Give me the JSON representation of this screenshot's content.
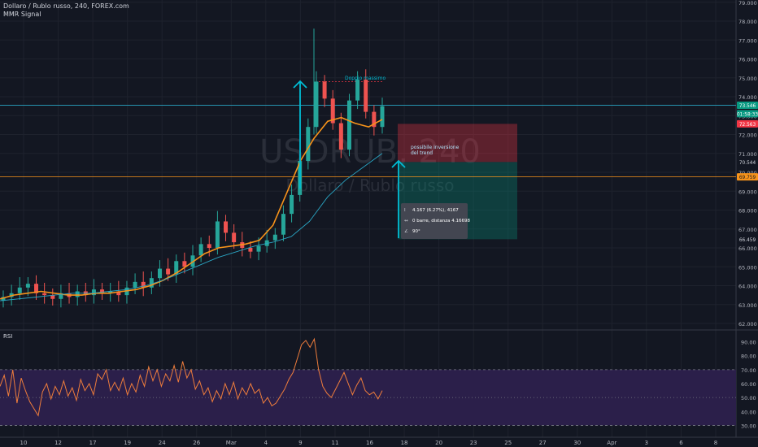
{
  "header": {
    "symbol_line": "Dollaro / Rublo russo, 240, FOREX.com",
    "indicator": "MMR Signal"
  },
  "watermark": {
    "ticker": "USDRUB, 240",
    "name": "Dollaro / Rublo russo"
  },
  "annotations": {
    "double_top": "Doppio massimo",
    "reversal_line1": "possibile inversione",
    "reversal_line2": "del trend"
  },
  "measure_tooltip": {
    "line1": "4.167 (6.27%), 4167",
    "line2": "0 barre, distanza 4.16698",
    "line3": "90°"
  },
  "rsi_panel": {
    "label": "RSI"
  },
  "price_badges": [
    {
      "label": "73.546",
      "value": 73.546,
      "bg": "#089981",
      "fg": "#ffffff"
    },
    {
      "label": "01:58:33",
      "value": 73.1,
      "bg": "#089981",
      "fg": "#ffffff"
    },
    {
      "label": "72.563",
      "value": 72.563,
      "bg": "#f23645",
      "fg": "#ffffff"
    },
    {
      "label": "70.544",
      "value": 70.544,
      "bg": "#131722",
      "fg": "#d1d4dc"
    },
    {
      "label": "69.759",
      "value": 69.759,
      "bg": "#f7931a",
      "fg": "#131722"
    },
    {
      "label": "66.459",
      "value": 66.459,
      "bg": "#131722",
      "fg": "#d1d4dc"
    }
  ],
  "colors": {
    "background": "#131722",
    "grid": "#1e222d",
    "up_candle": "#26a69a",
    "down_candle": "#ef5350",
    "ma_fast": "#f7931a",
    "ma_slow": "#2aa5c3",
    "rsi_line": "#ef7d3c",
    "rsi_band": "#2b1f4a",
    "arrow": "#00bcd4",
    "axis_text": "#b2b5be"
  },
  "chart_data": [
    {
      "type": "candlestick",
      "title": "Dollaro / Rublo russo, 240, FOREX.com",
      "ylim": [
        62,
        79
      ],
      "y_ticks": [
        "79.000",
        "78.000",
        "77.000",
        "76.000",
        "75.000",
        "74.000",
        "73.000",
        "72.000",
        "71.000",
        "70.000",
        "69.000",
        "68.000",
        "67.000",
        "66.000",
        "65.000",
        "64.000",
        "63.000",
        "62.000"
      ],
      "x_ticks": [
        "10",
        "12",
        "17",
        "19",
        "24",
        "26",
        "Mar",
        "4",
        "9",
        "11",
        "16",
        "18",
        "20",
        "23",
        "25",
        "27",
        "30",
        "Apr",
        "3",
        "6",
        "8"
      ],
      "close_approx": [
        63.4,
        63.6,
        63.9,
        64.1,
        63.6,
        63.5,
        63.3,
        63.6,
        63.4,
        63.7,
        63.5,
        63.8,
        63.6,
        63.7,
        63.5,
        63.9,
        64.2,
        63.9,
        64.4,
        64.9,
        64.6,
        65.3,
        65.0,
        65.6,
        66.2,
        66.0,
        67.4,
        66.8,
        66.3,
        66.0,
        65.8,
        66.1,
        66.4,
        66.7,
        67.8,
        68.8,
        70.6,
        72.4,
        74.8,
        73.9,
        72.6,
        71.2,
        73.8,
        74.9,
        73.2,
        72.4,
        73.5
      ],
      "series": [
        {
          "name": "",
          "values": [
            63.3,
            63.5,
            63.6,
            63.7,
            63.6,
            63.5,
            63.5,
            63.6,
            63.6,
            63.7,
            63.8,
            64.0,
            64.3,
            64.7,
            65.2,
            65.7,
            66.0,
            66.1,
            66.2,
            66.4,
            67.2,
            68.9,
            70.6,
            71.8,
            72.7,
            72.9,
            72.6,
            72.4,
            72.8
          ]
        },
        {
          "name": "",
          "values": [
            63.2,
            63.3,
            63.4,
            63.5,
            63.6,
            63.6,
            63.7,
            63.8,
            64.0,
            64.3,
            64.7,
            65.1,
            65.5,
            65.8,
            66.1,
            66.3,
            66.6,
            67.4,
            68.7,
            69.6,
            70.3,
            71.0
          ]
        }
      ],
      "levels": [
        73.546,
        69.759
      ],
      "double_top_level": 74.8,
      "position": {
        "entry": 70.544,
        "stop": 72.563,
        "target": 66.459
      }
    },
    {
      "type": "line",
      "title": "RSI",
      "ylim": [
        25,
        95
      ],
      "y_ticks": [
        "90.00",
        "80.00",
        "70.00",
        "60.00",
        "50.00",
        "40.00",
        "30.00"
      ],
      "band": [
        30,
        70
      ],
      "series": [
        {
          "name": "",
          "values": [
            58,
            66,
            51,
            70,
            46,
            64,
            55,
            47,
            42,
            37,
            54,
            60,
            49,
            58,
            52,
            62,
            51,
            57,
            48,
            63,
            55,
            60,
            52,
            67,
            63,
            70,
            55,
            61,
            55,
            64,
            52,
            60,
            54,
            66,
            58,
            72,
            62,
            70,
            58,
            67,
            62,
            73,
            61,
            76,
            64,
            70,
            56,
            62,
            52,
            57,
            47,
            55,
            49,
            60,
            52,
            61,
            49,
            57,
            52,
            60,
            53,
            56,
            46,
            50,
            44,
            46,
            51,
            56,
            63,
            68,
            78,
            88,
            91,
            86,
            92,
            70,
            58,
            53,
            50,
            56,
            62,
            68,
            60,
            52,
            59,
            64,
            55,
            52,
            54,
            49,
            55
          ]
        }
      ]
    }
  ]
}
